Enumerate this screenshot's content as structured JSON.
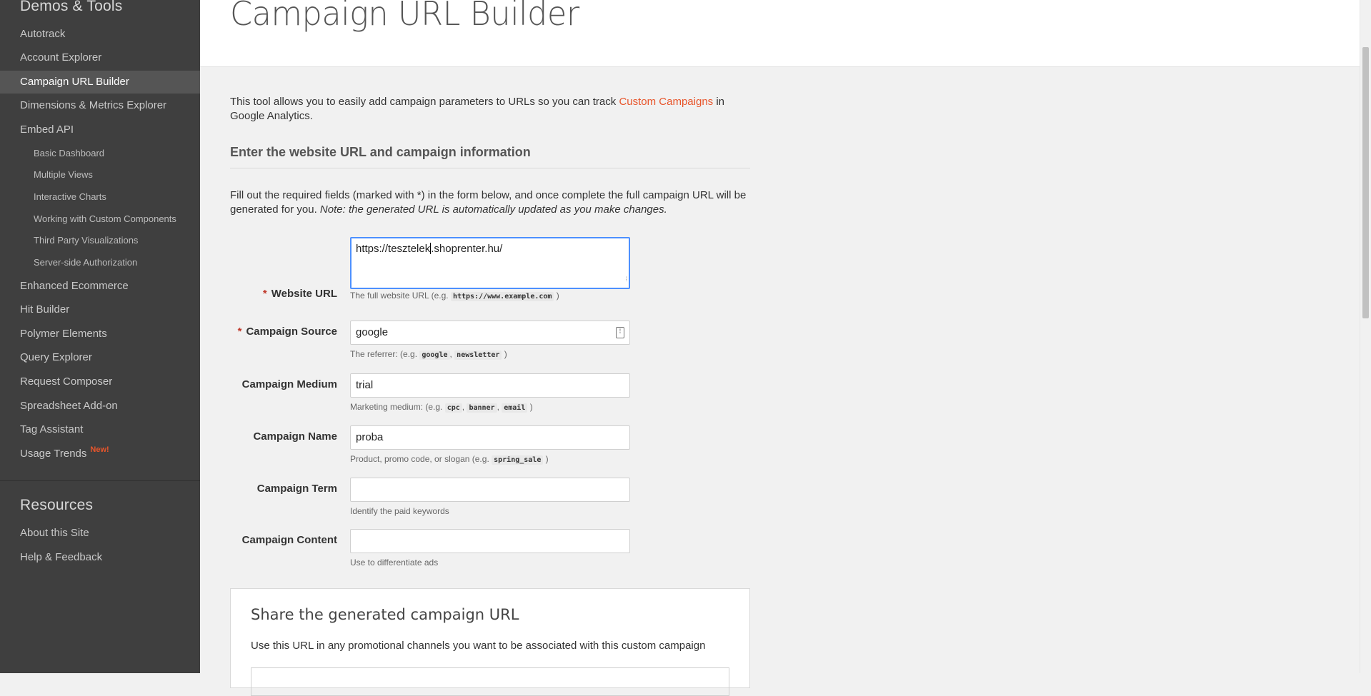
{
  "sidebar": {
    "demos_title": "Demos & Tools",
    "items": [
      {
        "label": "Autotrack"
      },
      {
        "label": "Account Explorer"
      },
      {
        "label": "Campaign URL Builder"
      },
      {
        "label": "Dimensions & Metrics Explorer"
      },
      {
        "label": "Embed API"
      }
    ],
    "subitems": [
      {
        "label": "Basic Dashboard"
      },
      {
        "label": "Multiple Views"
      },
      {
        "label": "Interactive Charts"
      },
      {
        "label": "Working with Custom Components"
      },
      {
        "label": "Third Party Visualizations"
      },
      {
        "label": "Server-side Authorization"
      }
    ],
    "items2": [
      {
        "label": "Enhanced Ecommerce"
      },
      {
        "label": "Hit Builder"
      },
      {
        "label": "Polymer Elements"
      },
      {
        "label": "Query Explorer"
      },
      {
        "label": "Request Composer"
      },
      {
        "label": "Spreadsheet Add-on"
      },
      {
        "label": "Tag Assistant"
      },
      {
        "label": "Usage Trends",
        "badge": "New!"
      }
    ],
    "resources_title": "Resources",
    "resources": [
      {
        "label": "About this Site"
      },
      {
        "label": "Help & Feedback"
      }
    ]
  },
  "header": {
    "title": "Campaign URL Builder"
  },
  "intro": {
    "text_before": "This tool allows you to easily add campaign parameters to URLs so you can track ",
    "link": "Custom Campaigns",
    "text_after": " in Google Analytics."
  },
  "subhead": "Enter the website URL and campaign information",
  "instructions": {
    "text": "Fill out the required fields (marked with *) in the form below, and once complete the full campaign URL will be generated for you. ",
    "note": "Note: the generated URL is automatically updated as you make changes."
  },
  "form": {
    "required_mark": "*",
    "website_url": {
      "label": "Website URL",
      "value_before_caret": "https://tesztelek",
      "value_after_caret": ".shoprenter.hu/",
      "hint_text": "The full website URL (e.g. ",
      "hint_code": "https://www.example.com",
      "hint_end": " )"
    },
    "source": {
      "label": "Campaign Source",
      "value": "google",
      "hint_text": "The referrer: (e.g. ",
      "hint_codes": [
        "google",
        "newsletter"
      ],
      "hint_end": " )"
    },
    "medium": {
      "label": "Campaign Medium",
      "value": "trial",
      "hint_text": "Marketing medium: (e.g. ",
      "hint_codes": [
        "cpc",
        "banner",
        "email"
      ],
      "hint_end": " )"
    },
    "name": {
      "label": "Campaign Name",
      "value": "proba",
      "hint_text": "Product, promo code, or slogan (e.g. ",
      "hint_code": "spring_sale",
      "hint_end": " )"
    },
    "term": {
      "label": "Campaign Term",
      "value": "",
      "hint": "Identify the paid keywords"
    },
    "content": {
      "label": "Campaign Content",
      "value": "",
      "hint": "Use to differentiate ads"
    }
  },
  "share": {
    "title": "Share the generated campaign URL",
    "description": "Use this URL in any promotional channels you want to be associated with this custom campaign"
  },
  "colors": {
    "accent": "#e8552b",
    "sidebar_bg": "#3f3f3f",
    "focus": "#4d90fe"
  }
}
